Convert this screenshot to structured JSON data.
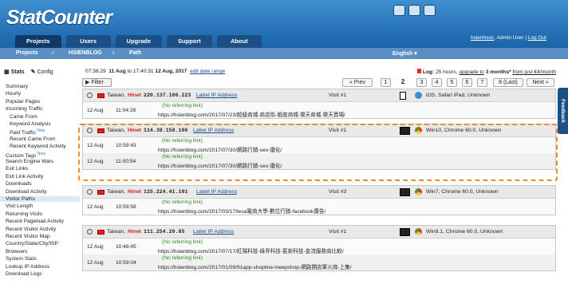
{
  "app": {
    "logo": "StatCounter"
  },
  "tabs": [
    "Projects",
    "Users",
    "Upgrade",
    "Support",
    "About"
  ],
  "user": {
    "name": "hsienhsoc",
    "role": ", Admin User",
    "sep": "|",
    "logout": "Log Out"
  },
  "breadcrumb": {
    "a": "Projects",
    "b": "HSIENBLOG",
    "c": "Path",
    "lang": "English ▾"
  },
  "sidebar": {
    "stats": "Stats",
    "config": "Config",
    "items": [
      {
        "label": "Summary"
      },
      {
        "label": "Hourly"
      },
      {
        "label": "Popular Pages"
      },
      {
        "label": "Incoming Traffic"
      },
      {
        "label": "Came From",
        "sub": true
      },
      {
        "label": "Keyword Analysis",
        "sub": true
      },
      {
        "label": "Paid Traffic",
        "sub": true,
        "badge": "New"
      },
      {
        "label": "Recent Came From",
        "sub": true
      },
      {
        "label": "Recent Keyword Activity",
        "sub": true
      },
      {
        "label": "Custom Tags",
        "badge": "New"
      },
      {
        "label": "Search Engine Wars"
      },
      {
        "label": "Exit Links"
      },
      {
        "label": "Exit Link Activity"
      },
      {
        "label": "Downloads"
      },
      {
        "label": "Download Activity"
      },
      {
        "label": "Visitor Paths",
        "selected": true
      },
      {
        "label": "Visit Length"
      },
      {
        "label": "Returning Visits"
      },
      {
        "label": "Recent Pageload Activity"
      },
      {
        "label": "Recent Visitor Activity"
      },
      {
        "label": "Recent Visitor Map"
      },
      {
        "label": "Country/State/City/ISP"
      },
      {
        "label": "Browsers"
      },
      {
        "label": "System Stats"
      },
      {
        "label": "Lookup IP Address"
      },
      {
        "label": "Download Logs"
      }
    ]
  },
  "range": {
    "t1": "07:38:29",
    "d1": "11 Aug",
    "to": "to 17:40:31",
    "d2": "12 Aug, 2017",
    "edit": "edit date range"
  },
  "log": {
    "label": "Log:",
    "text": "25 hours,",
    "upgrade": "upgrade to",
    "months": "3 months*",
    "price": "from just €4/month"
  },
  "filter": "▶ Filter",
  "pages": [
    "« Prev",
    "1",
    "2",
    "3",
    "4",
    "5",
    "6",
    "7",
    "8 (Last)",
    "Next »"
  ],
  "visits": [
    {
      "loc": "Taiwan,",
      "isp": "Hinet",
      "ip": "220.137.106.223",
      "label": "Label IP Address",
      "visit": "Visit #1",
      "sys": "iOS, Safari iPad, Unknown",
      "rows": [
        {
          "date": "12 Aug",
          "time": "11:04:28",
          "ref": "(No referring link)",
          "url": "https://hsienblog.com/2017/07/23/超級商城-商店街-蝦皮商城-樂天商城-樂天賣場/"
        }
      ]
    },
    {
      "loc": "Taiwan,",
      "isp": "Hinet",
      "ip": "114.39.158.106",
      "label": "Label IP Address",
      "visit": "Visit #1",
      "sys": "Win10, Chrome 60.0, Unknown",
      "rows": [
        {
          "date": "12 Aug",
          "time": "10:59:43",
          "ref": "(No referring link)",
          "url": "https://hsienblog.com/2017/07/30/網路行銷-seo-優化/"
        },
        {
          "date": "12 Aug",
          "time": "11:00:54",
          "ref": "(No referring link)",
          "url": "https://hsienblog.com/2017/07/30/網路行銷-seo-優化/"
        }
      ]
    },
    {
      "loc": "Taiwan,",
      "isp": "Hinet",
      "ip": "125.224.41.101",
      "label": "Label IP Address",
      "visit": "Visit #3",
      "sys": "Win7, Chrome 60.0, Unknown",
      "rows": [
        {
          "date": "12 Aug",
          "time": "10:59:58",
          "ref": "(No referring link)",
          "url": "https://hsienblog.com/2017/03/17/tesa電商大學-數位行銷-facebook廣告/"
        }
      ]
    },
    {
      "loc": "Taiwan,",
      "isp": "Hinet",
      "ip": "111.254.20.85",
      "label": "Label IP Address",
      "visit": "Visit #1",
      "sys": "Win8.1, Chrome 60.0, Unknown",
      "rows": [
        {
          "date": "12 Aug",
          "time": "10:48:45",
          "ref": "(No referring link)",
          "url": "https://hsienblog.com/2017/07/17/紅陽科技-綠界科技-藍新科技-金流服務商比較/"
        },
        {
          "date": "12 Aug",
          "time": "10:59:04",
          "ref": "(No referring link)",
          "url": "https://hsienblog.com/2017/01/09/91app-shopline-meepshop-網路開店軍火商-上集/"
        }
      ]
    }
  ],
  "feedback": "Feedback"
}
